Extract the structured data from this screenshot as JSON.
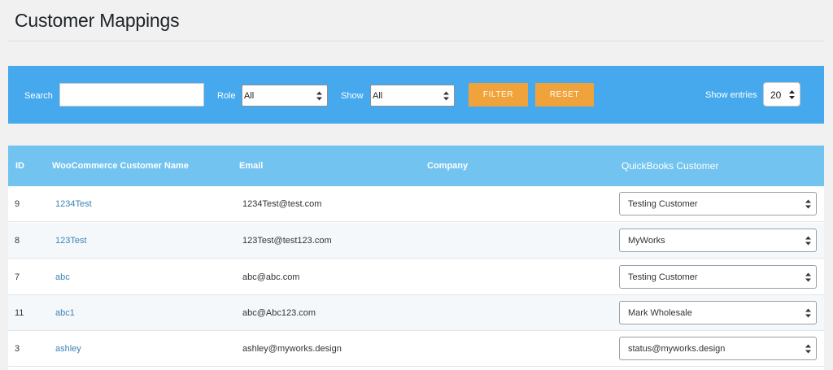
{
  "page": {
    "title": "Customer Mappings"
  },
  "filters": {
    "search_label": "Search",
    "search_value": "",
    "role_label": "Role",
    "role_value": "All",
    "show_label": "Show",
    "show_value": "All",
    "filter_button": "FILTER",
    "reset_button": "RESET",
    "entries_label": "Show entries",
    "entries_value": "20"
  },
  "colors": {
    "filter_bar": "#46a9ee",
    "table_header": "#72c3f0",
    "buttons": "#f0a23b",
    "link": "#3c83b5"
  },
  "table": {
    "headers": {
      "id": "ID",
      "name": "WooCommerce Customer Name",
      "email": "Email",
      "company": "Company",
      "qb": "QuickBooks Customer"
    },
    "rows": [
      {
        "id": "9",
        "name": "1234Test",
        "email": "1234Test@test.com",
        "company": "",
        "qb": "Testing Customer"
      },
      {
        "id": "8",
        "name": "123Test",
        "email": "123Test@test123.com",
        "company": "",
        "qb": "MyWorks"
      },
      {
        "id": "7",
        "name": "abc",
        "email": "abc@abc.com",
        "company": "",
        "qb": "Testing Customer"
      },
      {
        "id": "11",
        "name": "abc1",
        "email": "abc@Abc123.com",
        "company": "",
        "qb": "Mark Wholesale"
      },
      {
        "id": "3",
        "name": "ashley",
        "email": "ashley@myworks.design",
        "company": "",
        "qb": "status@myworks.design"
      }
    ]
  }
}
